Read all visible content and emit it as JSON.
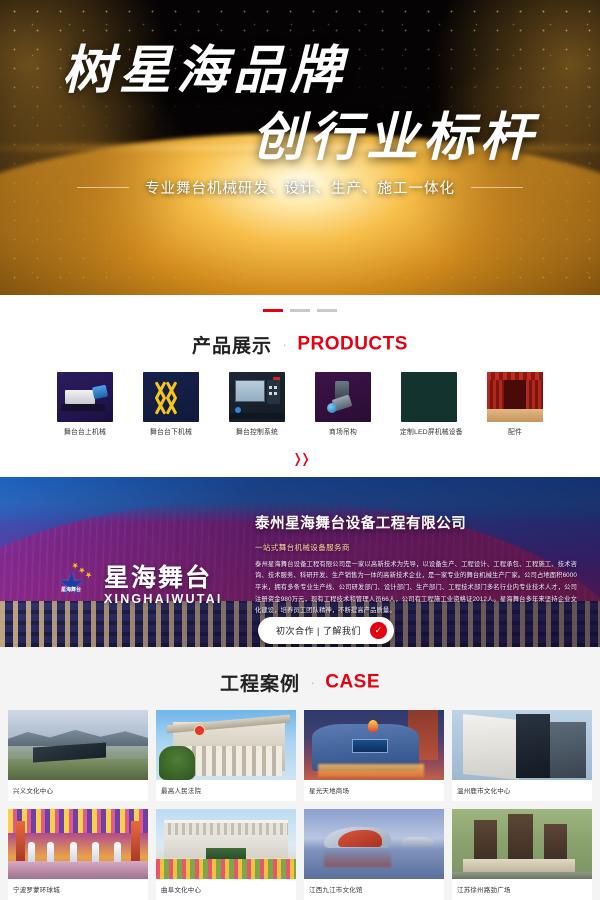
{
  "hero": {
    "title_line1": "树星海品牌",
    "title_line2": "创行业标杆",
    "subtitle": "专业舞台机械研发、设计、生产、施工一体化"
  },
  "slider": {
    "dots": [
      "slide-1",
      "slide-2",
      "slide-3"
    ],
    "active_index": 0,
    "active_color": "#e60012",
    "inactive_color": "#c9c9c9"
  },
  "products_section": {
    "heading_cn": "产品展示",
    "heading_sep": "·",
    "heading_en": "PRODUCTS",
    "scroll_icon": "chevron-double-down-icon",
    "items": [
      {
        "label": "舞台台上机械",
        "thumb": "stage-upper-machinery-thumb"
      },
      {
        "label": "舞台台下机械",
        "thumb": "stage-lower-machinery-thumb"
      },
      {
        "label": "舞台控制系统",
        "thumb": "stage-control-system-thumb"
      },
      {
        "label": "商场吊构",
        "thumb": "mall-suspension-structure-thumb"
      },
      {
        "label": "定制LED屏机械设备",
        "thumb": "custom-led-screen-equipment-thumb"
      },
      {
        "label": "配件",
        "thumb": "accessories-thumb"
      }
    ]
  },
  "about": {
    "logo_cn": "星海舞台",
    "logo_en": "XINGHAIWUTAI",
    "logo_badge": "星海舞台",
    "logo_badge_sub": "XINGHAIWUTAI",
    "title": "泰州星海舞台设备工程有限公司",
    "slogan": "一站式舞台机械设备服务商",
    "description": "泰州星海舞台设备工程有限公司是一家以高新技术为先导，以设备生产、工程设计、工程承包、工程施工、技术咨询、技术服务、科研开发、生产销售为一体的高新技术企业，是一家专业的舞台机械生产厂家。公司占地面积6000平米，拥有多条专业生产线、公司研发部门、设计部门、生产部门、工程技术部门多名行业内专业技术人才，公司注册资金980万元，现有工程技术和管理人员66人，公司有工程施工业资格证2012人。星海舞台多年来坚持企业文化建设，培养员工团队精神，不断提高产品质量。",
    "button_text": "初次合作 | 了解我们",
    "button_icon": "check-circle-icon"
  },
  "cases_section": {
    "heading_cn": "工程案例",
    "heading_sep": "·",
    "heading_en": "CASE",
    "items": [
      {
        "caption": "兴义文化中心",
        "art": "c1"
      },
      {
        "caption": "最高人民法院",
        "art": "c2"
      },
      {
        "caption": "星光天地商场",
        "art": "c3"
      },
      {
        "caption": "温州鹿市文化中心",
        "art": "c4"
      },
      {
        "caption": "宁波罗蒙环球城",
        "art": "c5"
      },
      {
        "caption": "曲阜文化中心",
        "art": "c6"
      },
      {
        "caption": "江西九江市文化馆",
        "art": "c7"
      },
      {
        "caption": "江苏徐州路劲广场",
        "art": "c8"
      }
    ]
  }
}
